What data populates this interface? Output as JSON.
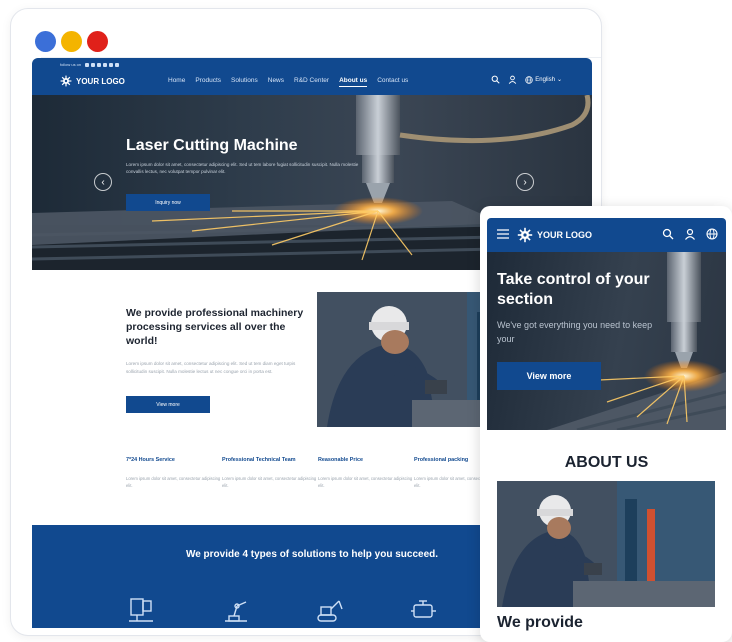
{
  "window": {
    "dots": [
      {
        "name": "blue-dot",
        "color": "#3b6fd8"
      },
      {
        "name": "yellow-dot",
        "color": "#f4b400"
      },
      {
        "name": "red-dot",
        "color": "#e0211a"
      }
    ]
  },
  "colors": {
    "brand": "#11498f",
    "text_dark": "#1d2430",
    "muted": "#9aa3ad"
  },
  "desktop": {
    "top_tiny_text": "follow us on",
    "logo": "YOUR LOGO",
    "nav": [
      "Home",
      "Products",
      "Solutions",
      "News",
      "R&D Center",
      "About us",
      "Contact us"
    ],
    "active_nav": "About us",
    "language": "English",
    "hero": {
      "title": "Laser Cutting Machine",
      "subtitle": "Lorem ipsum dolor sit amet, consectetur adipiscing elit. Sed ut tem labore fugiat sollicitudin suscipit. Nulla molestie convallis lectus, nec volutpat tempor pulvinar elit.",
      "button": "Inquiry now"
    },
    "about": {
      "title": "We provide professional machinery processing services all over the world!",
      "body": "Lorem ipsum dolor sit amet, consectetur adipiscing elit. Sed ut tem diam eget turpis sollicitudin suscipit. Nulla molestie lectus ut nec congue orci in porta est.",
      "button": "View more"
    },
    "features": [
      {
        "title": "7*24 Hours Service",
        "desc": "Lorem ipsum dolor sit amet, consectetur adipiscing elit."
      },
      {
        "title": "Professional Technical Team",
        "desc": "Lorem ipsum dolor sit amet, consectetur adipiscing elit."
      },
      {
        "title": "Reasonable Price",
        "desc": "Lorem ipsum dolor sit amet, consectetur adipiscing elit."
      },
      {
        "title": "Professional packing",
        "desc": "Lorem ipsum dolor sit amet, consectetur adipiscing elit."
      }
    ],
    "solutions": {
      "title": "We provide 4 types of solutions to help you succeed.",
      "icons": [
        "microscope-icon",
        "robot-arm-icon",
        "excavator-icon",
        "engine-icon"
      ]
    }
  },
  "mobile": {
    "logo": "YOUR LOGO",
    "hero": {
      "title": "Take control of your section",
      "subtitle": "We've got everything you need to keep your",
      "button": "View more"
    },
    "about_heading": "ABOUT US",
    "provide_heading": "We provide"
  }
}
